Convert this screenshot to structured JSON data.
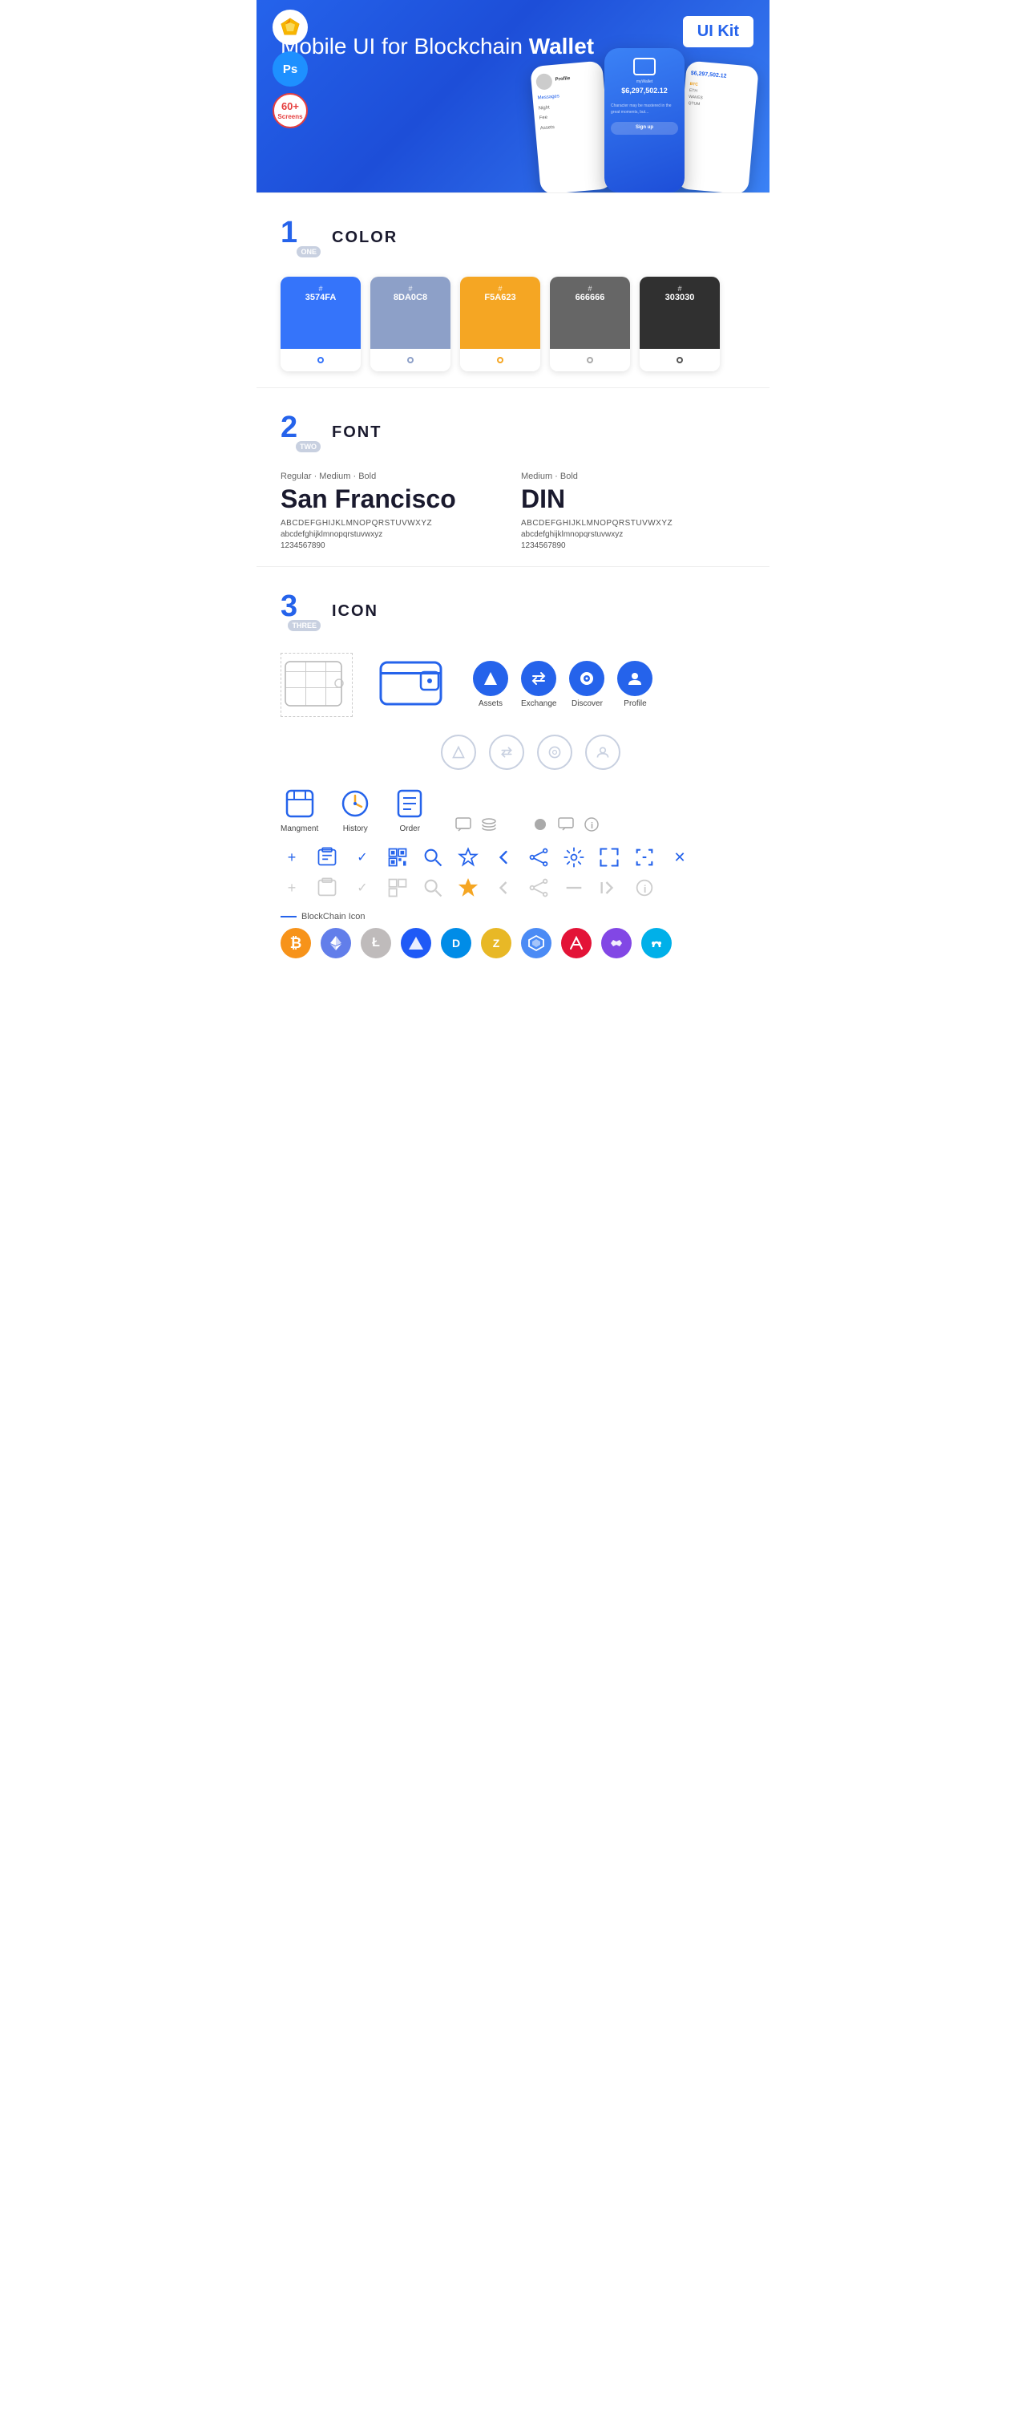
{
  "hero": {
    "title": "Mobile UI for Blockchain ",
    "title_bold": "Wallet",
    "badge": "UI Kit",
    "badge_sketch": "Sketch",
    "badge_ps": "Ps",
    "badge_screens": "60+\nScreens"
  },
  "sections": {
    "color": {
      "number": "1",
      "sub": "ONE",
      "title": "COLOR",
      "swatches": [
        {
          "hex": "#3574FA",
          "label": "#\n3574FA",
          "color": "#3574FA"
        },
        {
          "hex": "#8DA0C8",
          "label": "#\n8DA0C8",
          "color": "#8DA0C8"
        },
        {
          "hex": "#F5A623",
          "label": "#\nF5A623",
          "color": "#F5A623"
        },
        {
          "hex": "#666666",
          "label": "#\n666666",
          "color": "#666666"
        },
        {
          "hex": "#303030",
          "label": "#\n303030",
          "color": "#303030"
        }
      ]
    },
    "font": {
      "number": "2",
      "sub": "TWO",
      "title": "FONT",
      "fonts": [
        {
          "style_label": "Regular · Medium · Bold",
          "name": "San Francisco",
          "uppercase": "ABCDEFGHIJKLMNOPQRSTUVWXYZ",
          "lowercase": "abcdefghijklmnopqrstuvwxyz",
          "numbers": "1234567890"
        },
        {
          "style_label": "Medium · Bold",
          "name": "DIN",
          "uppercase": "ABCDEFGHIJKLMNOPQRSTUVWXYZ",
          "lowercase": "abcdefghijklmnopqrstuvwxyz",
          "numbers": "1234567890"
        }
      ]
    },
    "icon": {
      "number": "3",
      "sub": "THREE",
      "title": "ICON",
      "nav_icons": [
        {
          "label": "Assets",
          "color": "#2563eb"
        },
        {
          "label": "Exchange",
          "color": "#2563eb"
        },
        {
          "label": "Discover",
          "color": "#2563eb"
        },
        {
          "label": "Profile",
          "color": "#2563eb"
        }
      ],
      "bottom_nav_icons": [
        {
          "label": "Mangment"
        },
        {
          "label": "History"
        },
        {
          "label": "Order"
        }
      ],
      "blockchain_label": "BlockChain Icon",
      "crypto_coins": [
        "BTC",
        "ETH",
        "LTC",
        "WAVES",
        "DASH",
        "ZEN",
        "QTUM",
        "XVG",
        "GNT",
        "NU"
      ]
    }
  }
}
